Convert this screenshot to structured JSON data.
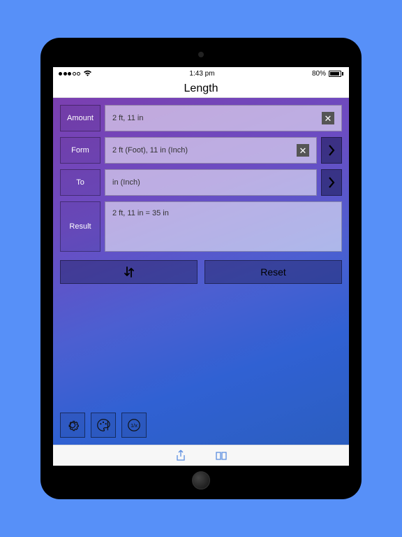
{
  "statusbar": {
    "time": "1:43 pm",
    "battery": "80%"
  },
  "title": "Length",
  "rows": {
    "amount": {
      "label": "Amount",
      "value": "2  ft, 11  in"
    },
    "form": {
      "label": "Form",
      "value": "2  ft (Foot), 11  in (Inch)"
    },
    "to": {
      "label": "To",
      "value": "in (Inch)"
    },
    "result": {
      "label": "Result",
      "value": "2  ft, 11  in = 35 in"
    }
  },
  "buttons": {
    "swap": "⇅",
    "reset": "Reset"
  }
}
